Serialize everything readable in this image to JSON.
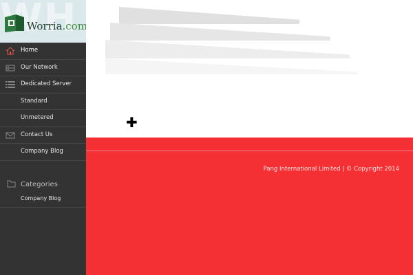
{
  "brand": {
    "name": "Worria",
    "domain": ".com",
    "ghost_text": "WH"
  },
  "nav": {
    "items": [
      {
        "label": "Home",
        "icon": "home-icon"
      },
      {
        "label": "Our Network",
        "icon": "server-icon"
      },
      {
        "label": "Dedicated Server",
        "icon": "list-icon"
      },
      {
        "label": "Standard",
        "icon": ""
      },
      {
        "label": "Unmetered",
        "icon": ""
      },
      {
        "label": "Contact Us",
        "icon": "envelope-icon"
      },
      {
        "label": "Company Blog",
        "icon": ""
      }
    ],
    "active": "Home"
  },
  "categories": {
    "heading": "Categories",
    "icon": "folder-icon",
    "items": [
      {
        "label": "Company Blog"
      }
    ]
  },
  "footer": {
    "copyright": "Pang International Limited | © Copyright 2014"
  },
  "colors": {
    "sidebar": "#333333",
    "footer": "#f53034",
    "accent_icon": "#e4574f"
  }
}
